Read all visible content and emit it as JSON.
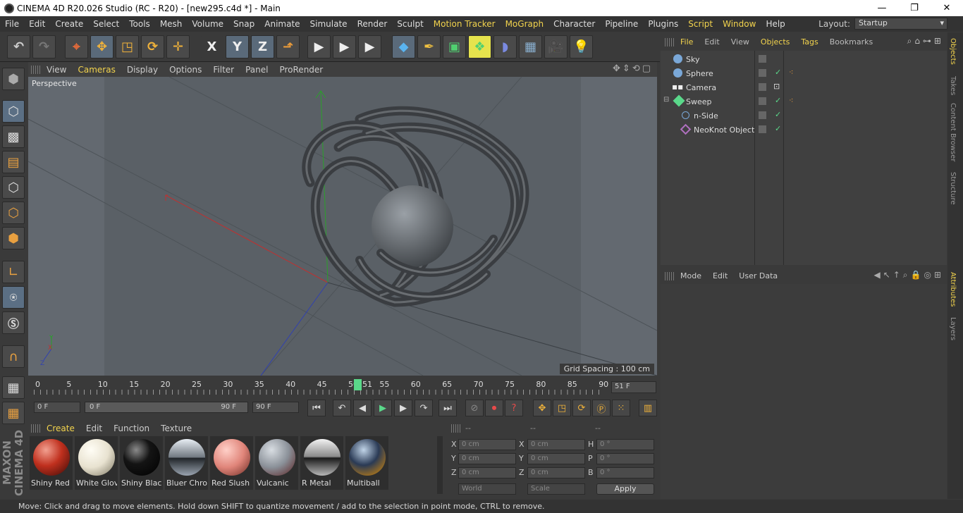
{
  "titlebar": {
    "title": "CINEMA 4D R20.026 Studio (RC - R20) - [new295.c4d *] - Main",
    "minimize": "—",
    "maximize": "❐",
    "close": "✕"
  },
  "menubar": {
    "items": [
      "File",
      "Edit",
      "Create",
      "Select",
      "Tools",
      "Mesh",
      "Volume",
      "Snap",
      "Animate",
      "Simulate",
      "Render",
      "Sculpt",
      "Motion Tracker",
      "MoGraph",
      "Character",
      "Pipeline",
      "Plugins",
      "Script",
      "Window",
      "Help"
    ],
    "highlighted": [
      "Motion Tracker",
      "MoGraph",
      "Script",
      "Window"
    ],
    "layout_label": "Layout:",
    "layout_value": "Startup"
  },
  "toolbar": {
    "x": "X",
    "y": "Y",
    "z": "Z"
  },
  "viewport": {
    "menu": [
      "View",
      "Cameras",
      "Display",
      "Options",
      "Filter",
      "Panel",
      "ProRender"
    ],
    "highlighted": [
      "Cameras"
    ],
    "camera_label": "Perspective",
    "grid_spacing": "Grid Spacing : 100 cm",
    "axis_x": "X",
    "axis_y": "Y",
    "axis_z": "Z"
  },
  "timeline": {
    "ticks": [
      "0",
      "5",
      "10",
      "15",
      "20",
      "25",
      "30",
      "35",
      "40",
      "45",
      "50",
      "55",
      "60",
      "65",
      "70",
      "75",
      "80",
      "85",
      "90"
    ],
    "current_frame": "51",
    "frame_field": "51 F"
  },
  "transport": {
    "start": "0 F",
    "range_start": "0 F",
    "range_end": "90 F",
    "end": "90 F"
  },
  "materials": {
    "menu": [
      "Create",
      "Edit",
      "Function",
      "Texture"
    ],
    "highlighted": [
      "Create"
    ],
    "items": [
      {
        "name": "Shiny Red",
        "color": "#c0301e"
      },
      {
        "name": "White Glov",
        "color": "#e8e2d0"
      },
      {
        "name": "Shiny Black",
        "color": "#141414"
      },
      {
        "name": "Bluer Chro",
        "color": "#9aa4b0"
      },
      {
        "name": "Red Slush",
        "color": "#e0857a"
      },
      {
        "name": "Vulcanic",
        "color": "#8a9098"
      },
      {
        "name": "R Metal",
        "color": "#b8b8b8"
      },
      {
        "name": "Multiball",
        "color": "#2a3a55"
      }
    ]
  },
  "coords": {
    "headers": [
      "--",
      "--",
      "--"
    ],
    "rows": [
      {
        "a": "X",
        "av": "0 cm",
        "b": "X",
        "bv": "0 cm",
        "c": "H",
        "cv": "0 °"
      },
      {
        "a": "Y",
        "av": "0 cm",
        "b": "Y",
        "bv": "0 cm",
        "c": "P",
        "cv": "0 °"
      },
      {
        "a": "Z",
        "av": "0 cm",
        "b": "Z",
        "bv": "0 cm",
        "c": "B",
        "cv": "0 °"
      }
    ],
    "world": "World",
    "scale": "Scale",
    "apply": "Apply"
  },
  "objects": {
    "menu": [
      "File",
      "Edit",
      "View",
      "Objects",
      "Tags",
      "Bookmarks"
    ],
    "highlighted": [
      "File",
      "Objects",
      "Tags"
    ],
    "rows": [
      {
        "name": "Sky",
        "indent": 0,
        "check": false,
        "tag": false
      },
      {
        "name": "Sphere",
        "indent": 0,
        "check": true,
        "tag": true
      },
      {
        "name": "Camera",
        "indent": 0,
        "check": false,
        "tag": false
      },
      {
        "name": "Sweep",
        "indent": 0,
        "check": true,
        "tag": true
      },
      {
        "name": "n-Side",
        "indent": 1,
        "check": true,
        "tag": false
      },
      {
        "name": "NeoKnot Object",
        "indent": 1,
        "check": true,
        "tag": false
      }
    ]
  },
  "attributes": {
    "menu": [
      "Mode",
      "Edit",
      "User Data"
    ]
  },
  "righttabs": [
    "Objects",
    "Takes",
    "Content Browser",
    "Structure",
    "Attributes",
    "Layers"
  ],
  "logo": "MAXON CINEMA 4D",
  "status": "Move: Click and drag to move elements. Hold down SHIFT to quantize movement / add to the selection in point mode, CTRL to remove."
}
